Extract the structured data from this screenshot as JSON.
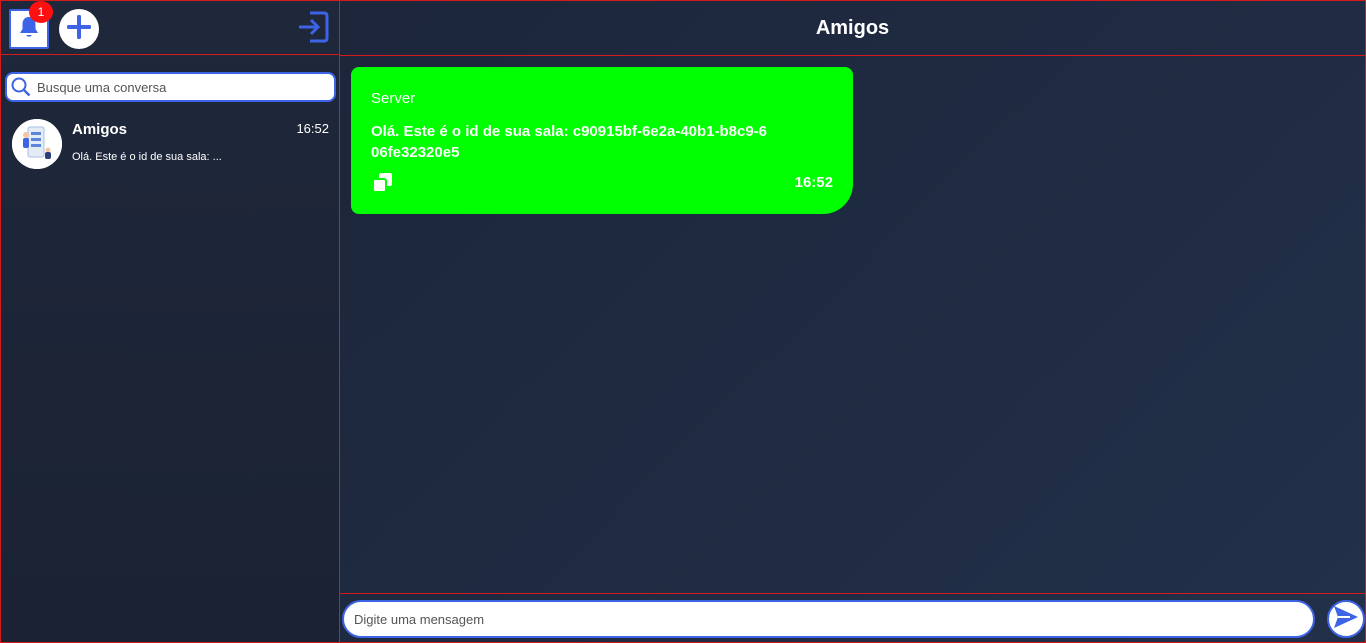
{
  "sidebar": {
    "notification_count": "1",
    "search": {
      "placeholder": "Busque uma conversa",
      "value": ""
    },
    "conversations": [
      {
        "name": "Amigos",
        "time": "16:52",
        "preview": "Olá. Este é o id de sua sala: ..."
      }
    ]
  },
  "chat": {
    "title": "Amigos",
    "messages": [
      {
        "sender": "Server",
        "text": "Olá. Este é o id de sua sala: c90915bf-6e2a-40b1-b8c9-606fe32320e5",
        "time": "16:52"
      }
    ],
    "composer": {
      "placeholder": "Digite uma mensagem",
      "value": ""
    }
  },
  "colors": {
    "accent": "#3d63e6",
    "border": "#d41b1b",
    "bubble": "#00ff00",
    "badge": "#ff1010"
  },
  "icons": {
    "bell": "bell-icon",
    "add": "plus-icon",
    "logout": "logout-icon",
    "search": "search-icon",
    "copy": "copy-icon",
    "send": "send-icon"
  }
}
